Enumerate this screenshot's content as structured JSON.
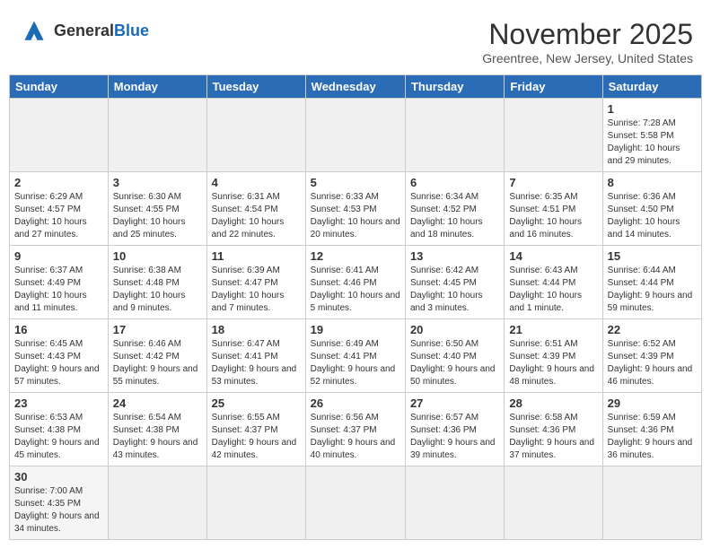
{
  "header": {
    "logo_text_general": "General",
    "logo_text_blue": "Blue",
    "month_title": "November 2025",
    "location": "Greentree, New Jersey, United States"
  },
  "days_of_week": [
    "Sunday",
    "Monday",
    "Tuesday",
    "Wednesday",
    "Thursday",
    "Friday",
    "Saturday"
  ],
  "weeks": [
    [
      {
        "day": "",
        "info": ""
      },
      {
        "day": "",
        "info": ""
      },
      {
        "day": "",
        "info": ""
      },
      {
        "day": "",
        "info": ""
      },
      {
        "day": "",
        "info": ""
      },
      {
        "day": "",
        "info": ""
      },
      {
        "day": "1",
        "info": "Sunrise: 7:28 AM\nSunset: 5:58 PM\nDaylight: 10 hours and 29 minutes."
      }
    ],
    [
      {
        "day": "2",
        "info": "Sunrise: 6:29 AM\nSunset: 4:57 PM\nDaylight: 10 hours and 27 minutes."
      },
      {
        "day": "3",
        "info": "Sunrise: 6:30 AM\nSunset: 4:55 PM\nDaylight: 10 hours and 25 minutes."
      },
      {
        "day": "4",
        "info": "Sunrise: 6:31 AM\nSunset: 4:54 PM\nDaylight: 10 hours and 22 minutes."
      },
      {
        "day": "5",
        "info": "Sunrise: 6:33 AM\nSunset: 4:53 PM\nDaylight: 10 hours and 20 minutes."
      },
      {
        "day": "6",
        "info": "Sunrise: 6:34 AM\nSunset: 4:52 PM\nDaylight: 10 hours and 18 minutes."
      },
      {
        "day": "7",
        "info": "Sunrise: 6:35 AM\nSunset: 4:51 PM\nDaylight: 10 hours and 16 minutes."
      },
      {
        "day": "8",
        "info": "Sunrise: 6:36 AM\nSunset: 4:50 PM\nDaylight: 10 hours and 14 minutes."
      }
    ],
    [
      {
        "day": "9",
        "info": "Sunrise: 6:37 AM\nSunset: 4:49 PM\nDaylight: 10 hours and 11 minutes."
      },
      {
        "day": "10",
        "info": "Sunrise: 6:38 AM\nSunset: 4:48 PM\nDaylight: 10 hours and 9 minutes."
      },
      {
        "day": "11",
        "info": "Sunrise: 6:39 AM\nSunset: 4:47 PM\nDaylight: 10 hours and 7 minutes."
      },
      {
        "day": "12",
        "info": "Sunrise: 6:41 AM\nSunset: 4:46 PM\nDaylight: 10 hours and 5 minutes."
      },
      {
        "day": "13",
        "info": "Sunrise: 6:42 AM\nSunset: 4:45 PM\nDaylight: 10 hours and 3 minutes."
      },
      {
        "day": "14",
        "info": "Sunrise: 6:43 AM\nSunset: 4:44 PM\nDaylight: 10 hours and 1 minute."
      },
      {
        "day": "15",
        "info": "Sunrise: 6:44 AM\nSunset: 4:44 PM\nDaylight: 9 hours and 59 minutes."
      }
    ],
    [
      {
        "day": "16",
        "info": "Sunrise: 6:45 AM\nSunset: 4:43 PM\nDaylight: 9 hours and 57 minutes."
      },
      {
        "day": "17",
        "info": "Sunrise: 6:46 AM\nSunset: 4:42 PM\nDaylight: 9 hours and 55 minutes."
      },
      {
        "day": "18",
        "info": "Sunrise: 6:47 AM\nSunset: 4:41 PM\nDaylight: 9 hours and 53 minutes."
      },
      {
        "day": "19",
        "info": "Sunrise: 6:49 AM\nSunset: 4:41 PM\nDaylight: 9 hours and 52 minutes."
      },
      {
        "day": "20",
        "info": "Sunrise: 6:50 AM\nSunset: 4:40 PM\nDaylight: 9 hours and 50 minutes."
      },
      {
        "day": "21",
        "info": "Sunrise: 6:51 AM\nSunset: 4:39 PM\nDaylight: 9 hours and 48 minutes."
      },
      {
        "day": "22",
        "info": "Sunrise: 6:52 AM\nSunset: 4:39 PM\nDaylight: 9 hours and 46 minutes."
      }
    ],
    [
      {
        "day": "23",
        "info": "Sunrise: 6:53 AM\nSunset: 4:38 PM\nDaylight: 9 hours and 45 minutes."
      },
      {
        "day": "24",
        "info": "Sunrise: 6:54 AM\nSunset: 4:38 PM\nDaylight: 9 hours and 43 minutes."
      },
      {
        "day": "25",
        "info": "Sunrise: 6:55 AM\nSunset: 4:37 PM\nDaylight: 9 hours and 42 minutes."
      },
      {
        "day": "26",
        "info": "Sunrise: 6:56 AM\nSunset: 4:37 PM\nDaylight: 9 hours and 40 minutes."
      },
      {
        "day": "27",
        "info": "Sunrise: 6:57 AM\nSunset: 4:36 PM\nDaylight: 9 hours and 39 minutes."
      },
      {
        "day": "28",
        "info": "Sunrise: 6:58 AM\nSunset: 4:36 PM\nDaylight: 9 hours and 37 minutes."
      },
      {
        "day": "29",
        "info": "Sunrise: 6:59 AM\nSunset: 4:36 PM\nDaylight: 9 hours and 36 minutes."
      }
    ],
    [
      {
        "day": "30",
        "info": "Sunrise: 7:00 AM\nSunset: 4:35 PM\nDaylight: 9 hours and 34 minutes."
      },
      {
        "day": "",
        "info": ""
      },
      {
        "day": "",
        "info": ""
      },
      {
        "day": "",
        "info": ""
      },
      {
        "day": "",
        "info": ""
      },
      {
        "day": "",
        "info": ""
      },
      {
        "day": "",
        "info": ""
      }
    ]
  ]
}
